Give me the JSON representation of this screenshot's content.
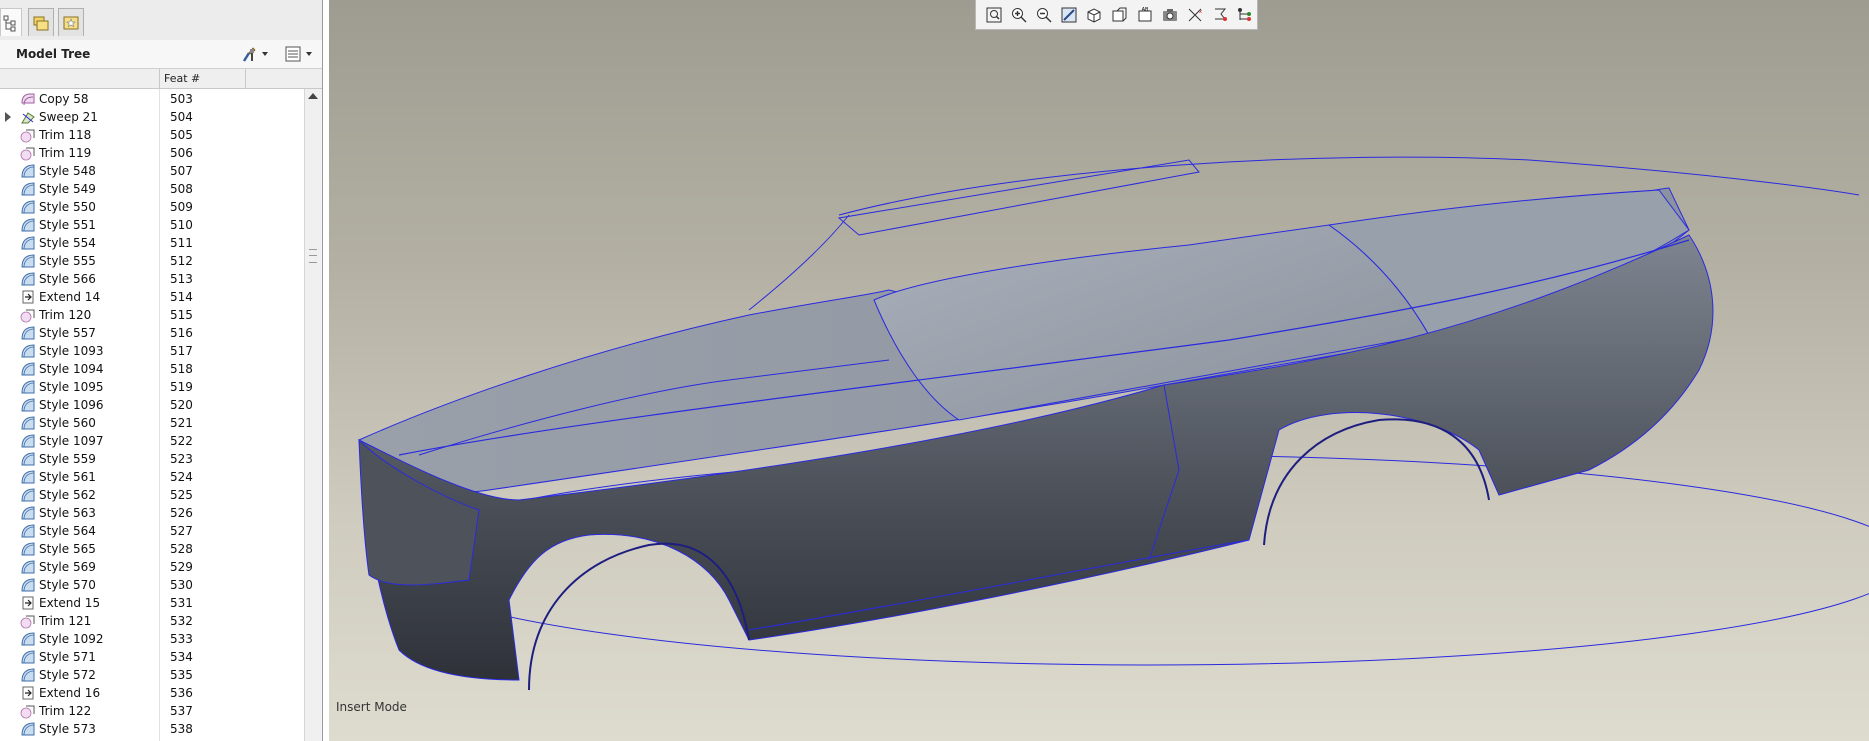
{
  "navigator": {
    "tabs": [
      {
        "name": "model-tree",
        "icon": "model-tree-icon"
      },
      {
        "name": "folder-browser",
        "icon": "folder-icon"
      },
      {
        "name": "favorites",
        "icon": "favorites-icon"
      }
    ],
    "title": "Model Tree",
    "column_header": "Feat #"
  },
  "tree_rows": [
    {
      "name": "Copy 58",
      "feat": "503",
      "icon": "copy-icon"
    },
    {
      "name": "Sweep 21",
      "feat": "504",
      "icon": "sweep-icon",
      "expandable": true
    },
    {
      "name": "Trim 118",
      "feat": "505",
      "icon": "trim-icon"
    },
    {
      "name": "Trim 119",
      "feat": "506",
      "icon": "trim-icon"
    },
    {
      "name": "Style 548",
      "feat": "507",
      "icon": "style-icon"
    },
    {
      "name": "Style 549",
      "feat": "508",
      "icon": "style-icon"
    },
    {
      "name": "Style 550",
      "feat": "509",
      "icon": "style-icon"
    },
    {
      "name": "Style 551",
      "feat": "510",
      "icon": "style-icon"
    },
    {
      "name": "Style 554",
      "feat": "511",
      "icon": "style-icon"
    },
    {
      "name": "Style 555",
      "feat": "512",
      "icon": "style-icon"
    },
    {
      "name": "Style 566",
      "feat": "513",
      "icon": "style-icon"
    },
    {
      "name": "Extend 14",
      "feat": "514",
      "icon": "extend-icon"
    },
    {
      "name": "Trim 120",
      "feat": "515",
      "icon": "trim-icon"
    },
    {
      "name": "Style 557",
      "feat": "516",
      "icon": "style-icon"
    },
    {
      "name": "Style 1093",
      "feat": "517",
      "icon": "style-icon"
    },
    {
      "name": "Style 1094",
      "feat": "518",
      "icon": "style-icon"
    },
    {
      "name": "Style 1095",
      "feat": "519",
      "icon": "style-icon"
    },
    {
      "name": "Style 1096",
      "feat": "520",
      "icon": "style-icon"
    },
    {
      "name": "Style 560",
      "feat": "521",
      "icon": "style-icon"
    },
    {
      "name": "Style 1097",
      "feat": "522",
      "icon": "style-icon"
    },
    {
      "name": "Style 559",
      "feat": "523",
      "icon": "style-icon"
    },
    {
      "name": "Style 561",
      "feat": "524",
      "icon": "style-icon"
    },
    {
      "name": "Style 562",
      "feat": "525",
      "icon": "style-icon"
    },
    {
      "name": "Style 563",
      "feat": "526",
      "icon": "style-icon"
    },
    {
      "name": "Style 564",
      "feat": "527",
      "icon": "style-icon"
    },
    {
      "name": "Style 565",
      "feat": "528",
      "icon": "style-icon"
    },
    {
      "name": "Style 569",
      "feat": "529",
      "icon": "style-icon"
    },
    {
      "name": "Style 570",
      "feat": "530",
      "icon": "style-icon"
    },
    {
      "name": "Extend 15",
      "feat": "531",
      "icon": "extend-icon"
    },
    {
      "name": "Trim 121",
      "feat": "532",
      "icon": "trim-icon"
    },
    {
      "name": "Style 1092",
      "feat": "533",
      "icon": "style-icon"
    },
    {
      "name": "Style 571",
      "feat": "534",
      "icon": "style-icon"
    },
    {
      "name": "Style 572",
      "feat": "535",
      "icon": "style-icon"
    },
    {
      "name": "Extend 16",
      "feat": "536",
      "icon": "extend-icon"
    },
    {
      "name": "Trim 122",
      "feat": "537",
      "icon": "trim-icon"
    },
    {
      "name": "Style 573",
      "feat": "538",
      "icon": "style-icon"
    }
  ],
  "graphics_toolbar": [
    "refit-icon",
    "zoom-in-icon",
    "zoom-out-icon",
    "repaint-icon",
    "saved-orientations-icon",
    "named-views-icon",
    "display-style-icon",
    "datum-display-icon",
    "spin-center-icon",
    "annotation-display-icon",
    "view-manager-icon"
  ],
  "status": {
    "mode": "Insert Mode"
  },
  "colors": {
    "viewport_top": "#9e9c91",
    "viewport_bottom": "#dedbcf",
    "surface": "#6f7580",
    "curve": "#2a2ae0"
  }
}
